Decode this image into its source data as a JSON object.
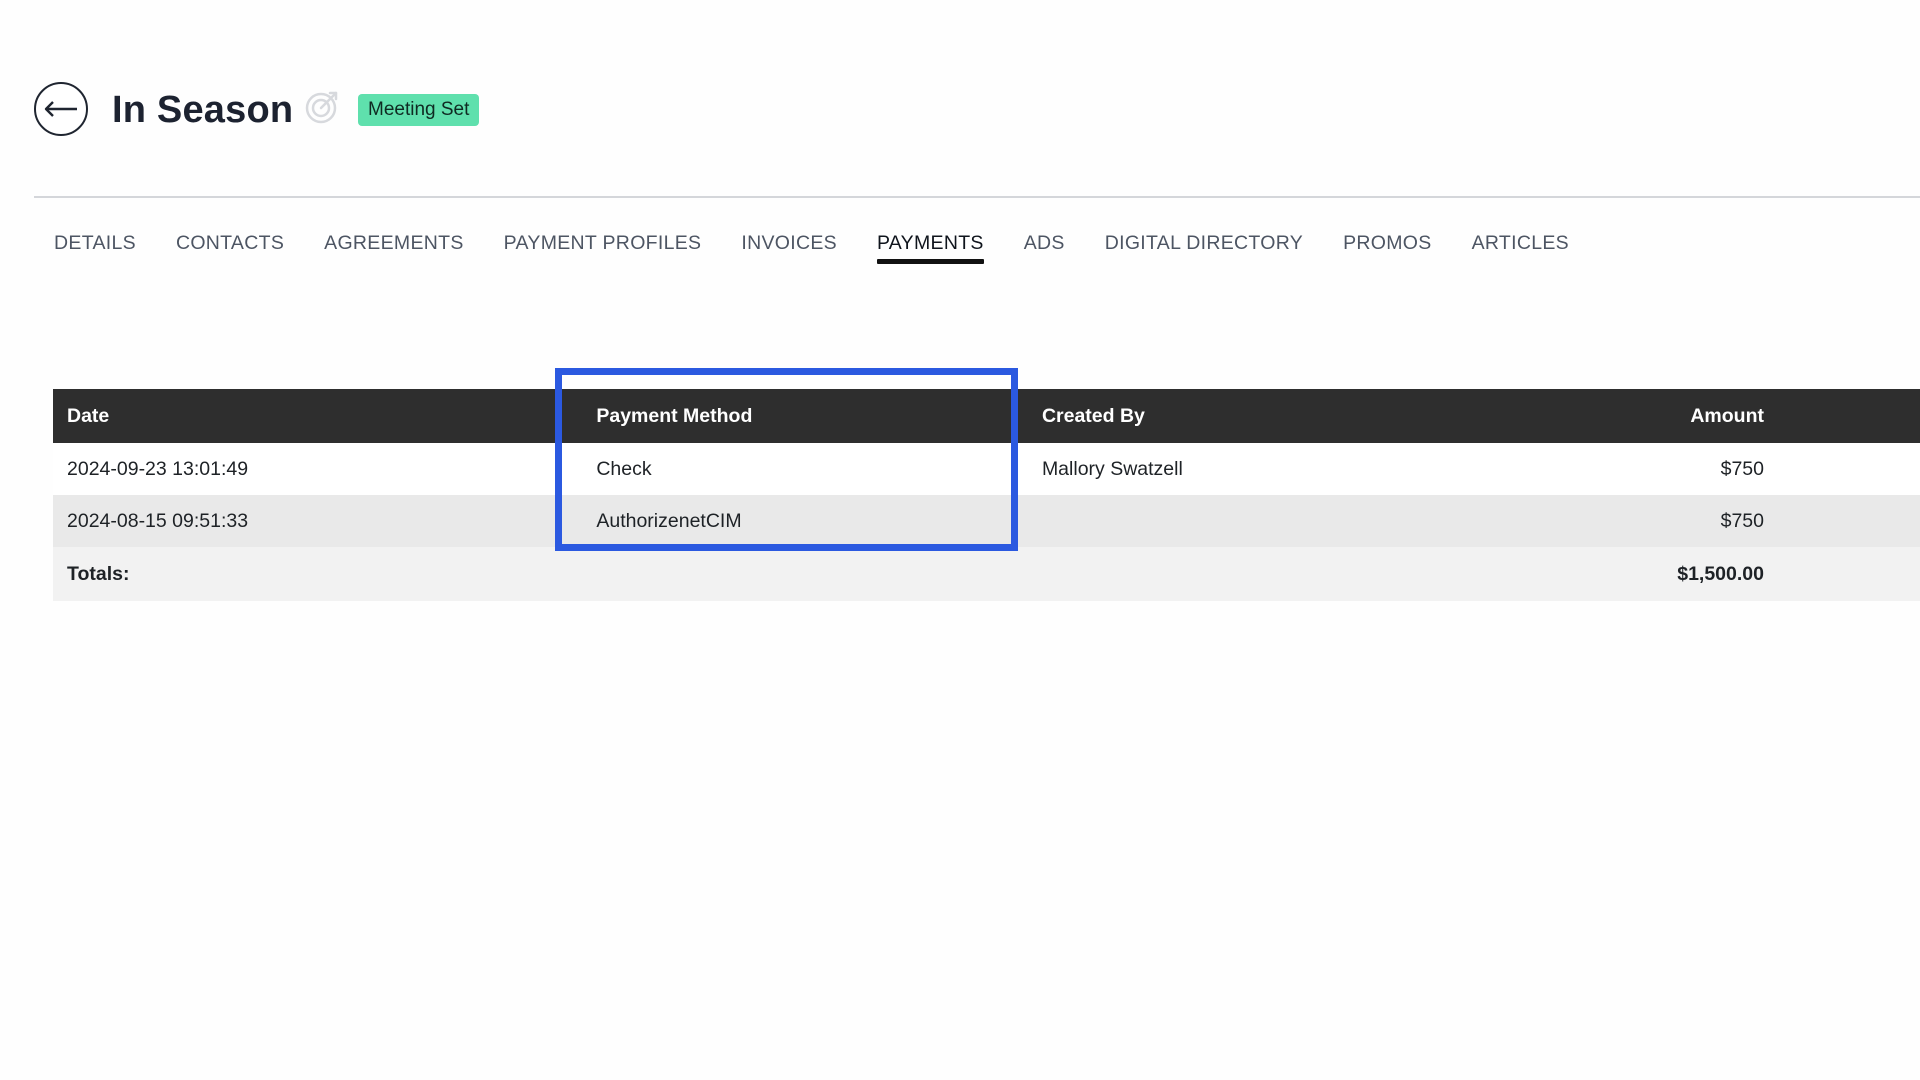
{
  "header": {
    "title": "In Season",
    "status_badge": "Meeting Set"
  },
  "tabs": [
    {
      "label": "DETAILS"
    },
    {
      "label": "CONTACTS"
    },
    {
      "label": "AGREEMENTS"
    },
    {
      "label": "PAYMENT PROFILES"
    },
    {
      "label": "INVOICES"
    },
    {
      "label": "PAYMENTS",
      "active": true
    },
    {
      "label": "ADS"
    },
    {
      "label": "DIGITAL DIRECTORY"
    },
    {
      "label": "PROMOS"
    },
    {
      "label": "ARTICLES"
    }
  ],
  "table": {
    "columns": [
      "Date",
      "Payment Method",
      "Created By",
      "Amount"
    ],
    "rows": [
      {
        "date": "2024-09-23 13:01:49",
        "method": "Check",
        "created_by": "Mallory Swatzell",
        "amount": "$750"
      },
      {
        "date": "2024-08-15 09:51:33",
        "method": "AuthorizenetCIM",
        "created_by": "",
        "amount": "$750"
      }
    ],
    "totals_label": "Totals:",
    "totals_amount": "$1,500.00"
  },
  "colors": {
    "badge": "#5fe0ad",
    "table_header": "#2e2e2e",
    "highlight": "#2b59e0"
  },
  "icons": [
    "back-arrow-icon",
    "target-icon"
  ]
}
